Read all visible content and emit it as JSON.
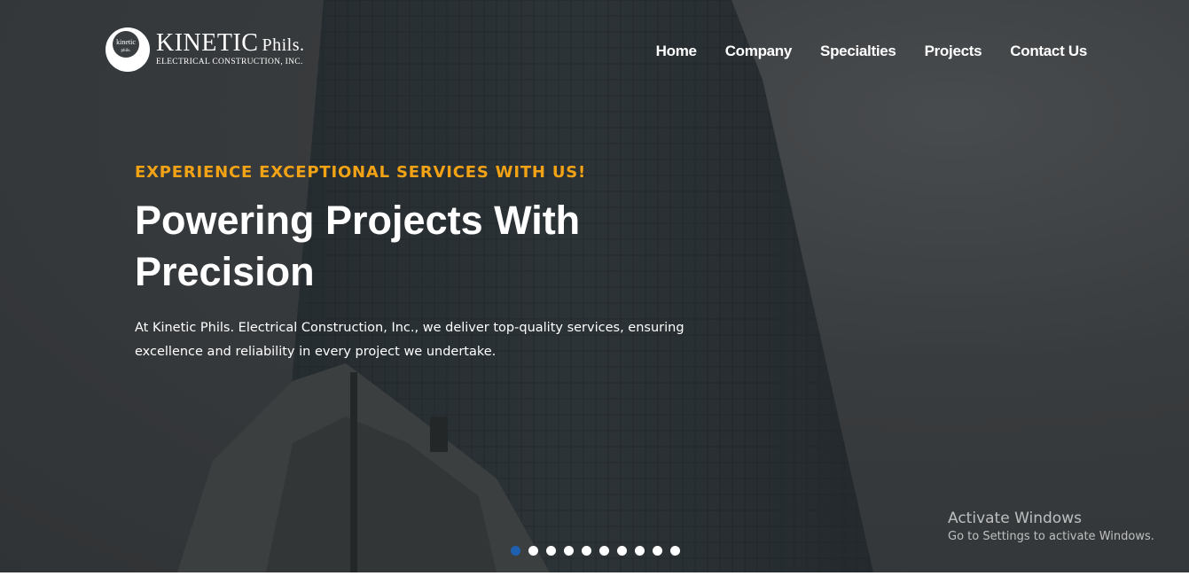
{
  "brand": {
    "name": "KINETIC",
    "name_suffix": "Phils.",
    "subtitle": "ELECTRICAL CONSTRUCTION, INC.",
    "logo_icon": "kinetic-circle-logo-icon"
  },
  "nav": {
    "items": [
      {
        "label": "Home"
      },
      {
        "label": "Company"
      },
      {
        "label": "Specialties"
      },
      {
        "label": "Projects"
      },
      {
        "label": "Contact Us"
      }
    ]
  },
  "hero": {
    "eyebrow": "EXPERIENCE EXCEPTIONAL SERVICES WITH US!",
    "headline_line1": "Powering Projects With",
    "headline_line2": "Precision",
    "description": "At Kinetic Phils. Electrical Construction, Inc., we deliver top-quality services, ensuring excellence and reliability in every project we undertake.",
    "accent_color": "#f2a315"
  },
  "carousel": {
    "slide_count": 10,
    "active_index": 0,
    "active_color": "#1f5fb0"
  },
  "watermark": {
    "title": "Activate Windows",
    "subtitle": "Go to Settings to activate Windows."
  }
}
